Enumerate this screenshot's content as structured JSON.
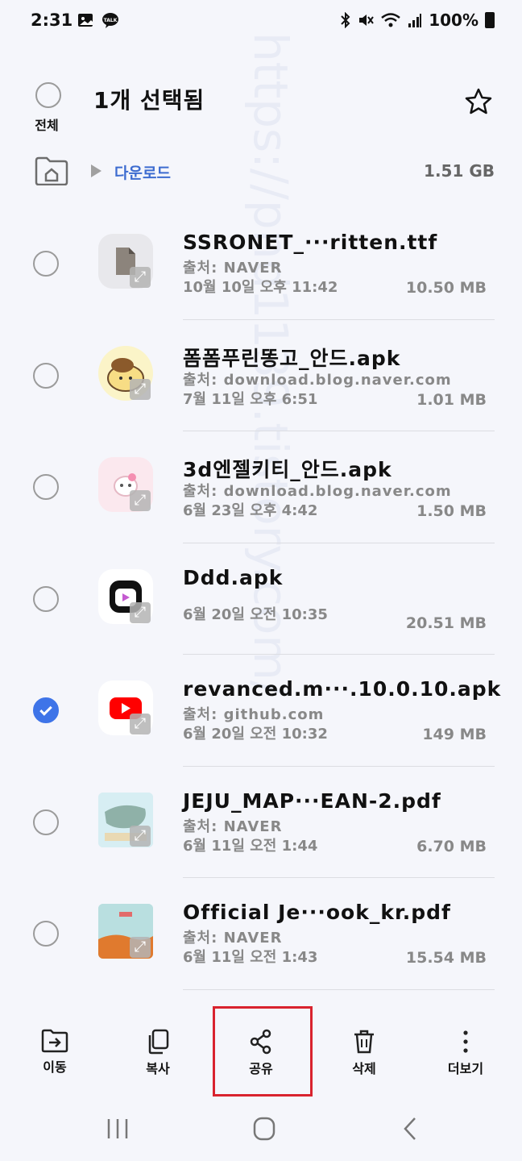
{
  "status_bar": {
    "time": "2:31",
    "battery": "100%"
  },
  "header": {
    "select_all_label": "전체",
    "title": "1개 선택됨"
  },
  "breadcrumb": {
    "folder": "다운로드",
    "storage_size": "1.51 GB"
  },
  "files": [
    {
      "name": "SSRONET_···ritten.ttf",
      "source": "출처: NAVER",
      "date": "10월 10일 오후 11:42",
      "size": "10.50 MB",
      "selected": false,
      "thumb": "document-icon"
    },
    {
      "name": "폼폼푸린똥고_안드.apk",
      "source": "출처: download.blog.naver.com",
      "date": "7월 11일 오후 6:51",
      "size": "1.01 MB",
      "selected": false,
      "thumb": "pompompurin-app-icon"
    },
    {
      "name": "3d엔젤키티_안드.apk",
      "source": "출처: download.blog.naver.com",
      "date": "6월 23일 오후 4:42",
      "size": "1.50 MB",
      "selected": false,
      "thumb": "kitty-app-icon"
    },
    {
      "name": "Ddd.apk",
      "source": "",
      "date": "6월 20일 오전 10:35",
      "size": "20.51 MB",
      "selected": false,
      "thumb": "ddd-app-icon"
    },
    {
      "name": "revanced.m···.10.0.10.apk",
      "source": "출처: github.com",
      "date": "6월 20일 오전 10:32",
      "size": "149 MB",
      "selected": true,
      "thumb": "youtube-icon"
    },
    {
      "name": "JEJU_MAP···EAN-2.pdf",
      "source": "출처: NAVER",
      "date": "6월 11일 오전 1:44",
      "size": "6.70 MB",
      "selected": false,
      "thumb": "map-pdf-thumbnail"
    },
    {
      "name": "Official Je···ook_kr.pdf",
      "source": "출처: NAVER",
      "date": "6월 11일 오전 1:43",
      "size": "15.54 MB",
      "selected": false,
      "thumb": "guidebook-pdf-thumbnail"
    }
  ],
  "toolbar": {
    "move_label": "이동",
    "copy_label": "복사",
    "share_label": "공유",
    "delete_label": "삭제",
    "more_label": "더보기"
  },
  "watermark": "https://phd1139.tistory.com/",
  "colors": {
    "accent": "#3e74e8",
    "highlight": "#d9232e",
    "folder_link": "#3d6cd0"
  }
}
